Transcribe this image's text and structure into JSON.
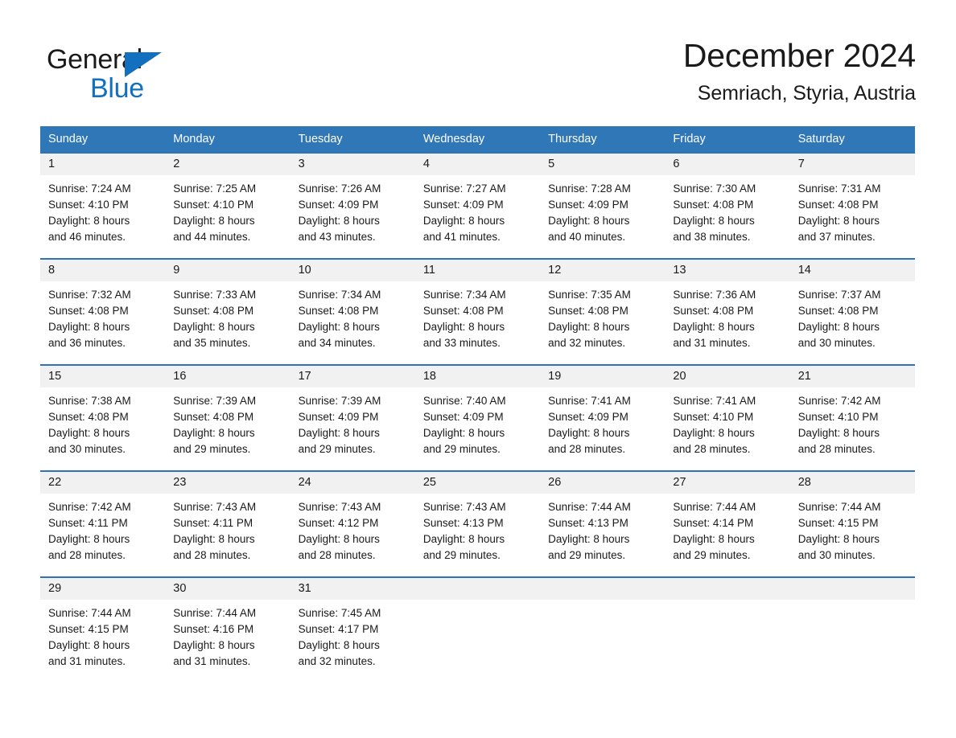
{
  "brand": {
    "name_part1": "General",
    "name_part2": "Blue",
    "triangle_color": "#1270bf"
  },
  "header": {
    "title": "December 2024",
    "subtitle": "Semriach, Styria, Austria"
  },
  "theme": {
    "header_blue": "#3077b8",
    "separator_blue": "#2e74b5",
    "daynum_band": "#f1f1f1",
    "text": "#1a1a1a",
    "logo_blue": "#1270bf"
  },
  "weekday_headers": [
    "Sunday",
    "Monday",
    "Tuesday",
    "Wednesday",
    "Thursday",
    "Friday",
    "Saturday"
  ],
  "weeks": [
    {
      "numbers": [
        "1",
        "2",
        "3",
        "4",
        "5",
        "6",
        "7"
      ],
      "cells": [
        {
          "sunrise": "Sunrise: 7:24 AM",
          "sunset": "Sunset: 4:10 PM",
          "daylight1": "Daylight: 8 hours",
          "daylight2": "and 46 minutes."
        },
        {
          "sunrise": "Sunrise: 7:25 AM",
          "sunset": "Sunset: 4:10 PM",
          "daylight1": "Daylight: 8 hours",
          "daylight2": "and 44 minutes."
        },
        {
          "sunrise": "Sunrise: 7:26 AM",
          "sunset": "Sunset: 4:09 PM",
          "daylight1": "Daylight: 8 hours",
          "daylight2": "and 43 minutes."
        },
        {
          "sunrise": "Sunrise: 7:27 AM",
          "sunset": "Sunset: 4:09 PM",
          "daylight1": "Daylight: 8 hours",
          "daylight2": "and 41 minutes."
        },
        {
          "sunrise": "Sunrise: 7:28 AM",
          "sunset": "Sunset: 4:09 PM",
          "daylight1": "Daylight: 8 hours",
          "daylight2": "and 40 minutes."
        },
        {
          "sunrise": "Sunrise: 7:30 AM",
          "sunset": "Sunset: 4:08 PM",
          "daylight1": "Daylight: 8 hours",
          "daylight2": "and 38 minutes."
        },
        {
          "sunrise": "Sunrise: 7:31 AM",
          "sunset": "Sunset: 4:08 PM",
          "daylight1": "Daylight: 8 hours",
          "daylight2": "and 37 minutes."
        }
      ]
    },
    {
      "numbers": [
        "8",
        "9",
        "10",
        "11",
        "12",
        "13",
        "14"
      ],
      "cells": [
        {
          "sunrise": "Sunrise: 7:32 AM",
          "sunset": "Sunset: 4:08 PM",
          "daylight1": "Daylight: 8 hours",
          "daylight2": "and 36 minutes."
        },
        {
          "sunrise": "Sunrise: 7:33 AM",
          "sunset": "Sunset: 4:08 PM",
          "daylight1": "Daylight: 8 hours",
          "daylight2": "and 35 minutes."
        },
        {
          "sunrise": "Sunrise: 7:34 AM",
          "sunset": "Sunset: 4:08 PM",
          "daylight1": "Daylight: 8 hours",
          "daylight2": "and 34 minutes."
        },
        {
          "sunrise": "Sunrise: 7:34 AM",
          "sunset": "Sunset: 4:08 PM",
          "daylight1": "Daylight: 8 hours",
          "daylight2": "and 33 minutes."
        },
        {
          "sunrise": "Sunrise: 7:35 AM",
          "sunset": "Sunset: 4:08 PM",
          "daylight1": "Daylight: 8 hours",
          "daylight2": "and 32 minutes."
        },
        {
          "sunrise": "Sunrise: 7:36 AM",
          "sunset": "Sunset: 4:08 PM",
          "daylight1": "Daylight: 8 hours",
          "daylight2": "and 31 minutes."
        },
        {
          "sunrise": "Sunrise: 7:37 AM",
          "sunset": "Sunset: 4:08 PM",
          "daylight1": "Daylight: 8 hours",
          "daylight2": "and 30 minutes."
        }
      ]
    },
    {
      "numbers": [
        "15",
        "16",
        "17",
        "18",
        "19",
        "20",
        "21"
      ],
      "cells": [
        {
          "sunrise": "Sunrise: 7:38 AM",
          "sunset": "Sunset: 4:08 PM",
          "daylight1": "Daylight: 8 hours",
          "daylight2": "and 30 minutes."
        },
        {
          "sunrise": "Sunrise: 7:39 AM",
          "sunset": "Sunset: 4:08 PM",
          "daylight1": "Daylight: 8 hours",
          "daylight2": "and 29 minutes."
        },
        {
          "sunrise": "Sunrise: 7:39 AM",
          "sunset": "Sunset: 4:09 PM",
          "daylight1": "Daylight: 8 hours",
          "daylight2": "and 29 minutes."
        },
        {
          "sunrise": "Sunrise: 7:40 AM",
          "sunset": "Sunset: 4:09 PM",
          "daylight1": "Daylight: 8 hours",
          "daylight2": "and 29 minutes."
        },
        {
          "sunrise": "Sunrise: 7:41 AM",
          "sunset": "Sunset: 4:09 PM",
          "daylight1": "Daylight: 8 hours",
          "daylight2": "and 28 minutes."
        },
        {
          "sunrise": "Sunrise: 7:41 AM",
          "sunset": "Sunset: 4:10 PM",
          "daylight1": "Daylight: 8 hours",
          "daylight2": "and 28 minutes."
        },
        {
          "sunrise": "Sunrise: 7:42 AM",
          "sunset": "Sunset: 4:10 PM",
          "daylight1": "Daylight: 8 hours",
          "daylight2": "and 28 minutes."
        }
      ]
    },
    {
      "numbers": [
        "22",
        "23",
        "24",
        "25",
        "26",
        "27",
        "28"
      ],
      "cells": [
        {
          "sunrise": "Sunrise: 7:42 AM",
          "sunset": "Sunset: 4:11 PM",
          "daylight1": "Daylight: 8 hours",
          "daylight2": "and 28 minutes."
        },
        {
          "sunrise": "Sunrise: 7:43 AM",
          "sunset": "Sunset: 4:11 PM",
          "daylight1": "Daylight: 8 hours",
          "daylight2": "and 28 minutes."
        },
        {
          "sunrise": "Sunrise: 7:43 AM",
          "sunset": "Sunset: 4:12 PM",
          "daylight1": "Daylight: 8 hours",
          "daylight2": "and 28 minutes."
        },
        {
          "sunrise": "Sunrise: 7:43 AM",
          "sunset": "Sunset: 4:13 PM",
          "daylight1": "Daylight: 8 hours",
          "daylight2": "and 29 minutes."
        },
        {
          "sunrise": "Sunrise: 7:44 AM",
          "sunset": "Sunset: 4:13 PM",
          "daylight1": "Daylight: 8 hours",
          "daylight2": "and 29 minutes."
        },
        {
          "sunrise": "Sunrise: 7:44 AM",
          "sunset": "Sunset: 4:14 PM",
          "daylight1": "Daylight: 8 hours",
          "daylight2": "and 29 minutes."
        },
        {
          "sunrise": "Sunrise: 7:44 AM",
          "sunset": "Sunset: 4:15 PM",
          "daylight1": "Daylight: 8 hours",
          "daylight2": "and 30 minutes."
        }
      ]
    },
    {
      "numbers": [
        "29",
        "30",
        "31",
        "",
        "",
        "",
        ""
      ],
      "cells": [
        {
          "sunrise": "Sunrise: 7:44 AM",
          "sunset": "Sunset: 4:15 PM",
          "daylight1": "Daylight: 8 hours",
          "daylight2": "and 31 minutes."
        },
        {
          "sunrise": "Sunrise: 7:44 AM",
          "sunset": "Sunset: 4:16 PM",
          "daylight1": "Daylight: 8 hours",
          "daylight2": "and 31 minutes."
        },
        {
          "sunrise": "Sunrise: 7:45 AM",
          "sunset": "Sunset: 4:17 PM",
          "daylight1": "Daylight: 8 hours",
          "daylight2": "and 32 minutes."
        },
        {
          "sunrise": "",
          "sunset": "",
          "daylight1": "",
          "daylight2": ""
        },
        {
          "sunrise": "",
          "sunset": "",
          "daylight1": "",
          "daylight2": ""
        },
        {
          "sunrise": "",
          "sunset": "",
          "daylight1": "",
          "daylight2": ""
        },
        {
          "sunrise": "",
          "sunset": "",
          "daylight1": "",
          "daylight2": ""
        }
      ]
    }
  ]
}
